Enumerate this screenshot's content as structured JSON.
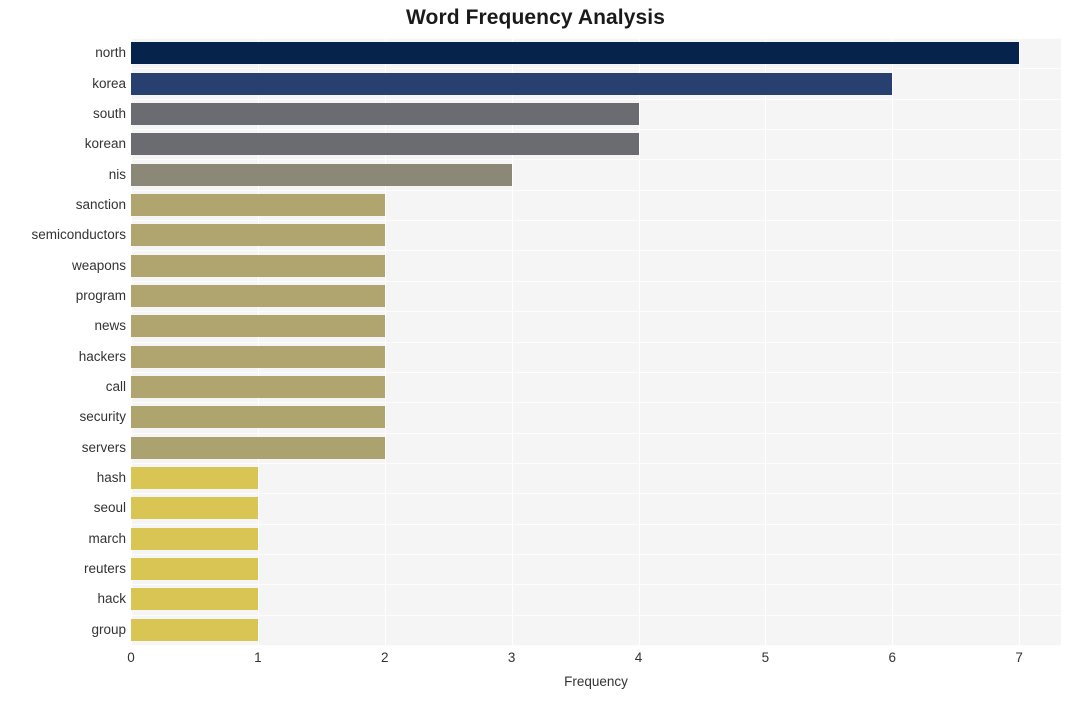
{
  "chart_data": {
    "type": "bar",
    "orientation": "horizontal",
    "title": "Word Frequency Analysis",
    "xlabel": "Frequency",
    "ylabel": "",
    "xlim": [
      0,
      7.33
    ],
    "xticks": [
      0,
      1,
      2,
      3,
      4,
      5,
      6,
      7
    ],
    "xtick_labels": [
      "0",
      "1",
      "2",
      "3",
      "4",
      "5",
      "6",
      "7"
    ],
    "grid": true,
    "grid_axis": "both",
    "legend": null,
    "plot_background": "#f5f5f6",
    "figure_background": "#ffffff",
    "categories": [
      "north",
      "korea",
      "south",
      "korean",
      "nis",
      "sanction",
      "semiconductors",
      "weapons",
      "program",
      "news",
      "hackers",
      "call",
      "security",
      "servers",
      "hash",
      "seoul",
      "march",
      "reuters",
      "hack",
      "group"
    ],
    "values": [
      7,
      6,
      4,
      4,
      3,
      2,
      2,
      2,
      2,
      2,
      2,
      2,
      2,
      2,
      1,
      1,
      1,
      1,
      1,
      1
    ],
    "bar_colors": [
      "#06234b",
      "#27406f",
      "#6b6c72",
      "#6b6c72",
      "#8b8878",
      "#b0a56f",
      "#b0a56f",
      "#b0a56f",
      "#b0a56f",
      "#b0a56f",
      "#b0a56f",
      "#b0a56f",
      "#aea46e",
      "#aba26f",
      "#d9c554",
      "#d9c554",
      "#d9c554",
      "#d9c554",
      "#d9c554",
      "#d9c554"
    ]
  }
}
